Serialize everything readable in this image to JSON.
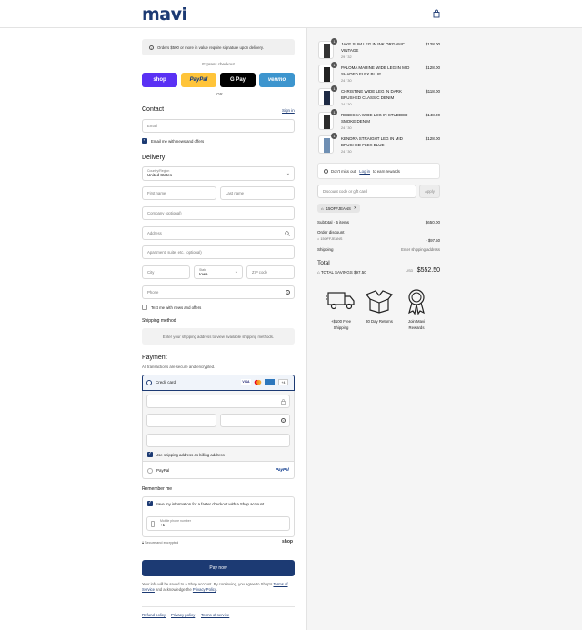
{
  "header": {
    "logo": "mavi",
    "cart_icon": "shopping-bag-icon"
  },
  "notice": {
    "text": "Orders $500 or more in value require signature upon delivery."
  },
  "express": {
    "title": "Express checkout",
    "buttons": [
      {
        "label": "shop",
        "color": "#5a31f4"
      },
      {
        "label": "PayPal",
        "color": "#ffc439"
      },
      {
        "label": "G Pay",
        "color": "#000000"
      },
      {
        "label": "venmo",
        "color": "#3d95ce"
      }
    ],
    "or": "OR"
  },
  "contact": {
    "title": "Contact",
    "signin": "Sign in",
    "email_placeholder": "Email",
    "email_news": "Email me with news and offers"
  },
  "delivery": {
    "title": "Delivery",
    "country_label": "Country/Region",
    "country_value": "United States",
    "first_name": "First name",
    "last_name": "Last name",
    "company": "Company (optional)",
    "address": "Address",
    "apartment": "Apartment, suite, etc. (optional)",
    "city": "City",
    "state_label": "State",
    "state_value": "Iowa",
    "zip": "ZIP code",
    "phone": "Phone",
    "text_news": "Text me with news and offers"
  },
  "shipping_method": {
    "title": "Shipping method",
    "message": "Enter your shipping address to view available shipping methods."
  },
  "payment": {
    "title": "Payment",
    "subtitle": "All transactions are secure and encrypted.",
    "credit_card": "Credit card",
    "card_brands": [
      "visa",
      "mastercard",
      "amex"
    ],
    "more": "+4",
    "billing": "Use shipping address as billing address",
    "paypal": "PayPal",
    "paypal_logo": "PayPal"
  },
  "remember": {
    "title": "Remember me",
    "save_info": "Save my information for a faster checkout with a Shop account",
    "mobile_label": "Mobile phone number",
    "mobile_value": "+1",
    "secure": "Secure and encrypted",
    "shop": "shop"
  },
  "pay_now": "Pay now",
  "legal": {
    "text1": "Your info will be saved to a Shop account. By continuing, you agree to Shop's",
    "terms": "Terms of Service",
    "text2": "and acknowledge the",
    "privacy": "Privacy Policy",
    "end": "."
  },
  "footer": [
    "Refund policy",
    "Privacy policy",
    "Terms of service"
  ],
  "items": [
    {
      "qty": "1",
      "name": "JAKE SLIM LEG IN INK ORGANIC VINTAGE",
      "variant": "29 / 32",
      "price": "$128.00"
    },
    {
      "qty": "1",
      "name": "PALOMA MARINE WIDE LEG IN MID SHADED FLEX BLUE",
      "variant": "24 / 30",
      "price": "$128.00"
    },
    {
      "qty": "1",
      "name": "CHRISTINE WIDE LEG IN DARK BRUSHED CLASSIC DENIM",
      "variant": "24 / 30",
      "price": "$118.00"
    },
    {
      "qty": "1",
      "name": "REBECCA WIDE LEG IN STUDDED SMOKE DENIM",
      "variant": "24 / 30",
      "price": "$148.00"
    },
    {
      "qty": "1",
      "name": "KENDRA STRAIGHT LEG IN MID BRUSHED FLEX BLUE",
      "variant": "24 / 30",
      "price": "$128.00"
    }
  ],
  "rewards": {
    "pre": "Don't miss out!",
    "link": "Log in",
    "post": "to earn rewards"
  },
  "discount": {
    "placeholder": "Discount code or gift card",
    "apply": "Apply",
    "tag": "15OFFJEANS"
  },
  "totals": {
    "subtotal_label": "Subtotal · 5 items",
    "subtotal": "$650.00",
    "order_discount": "Order discount",
    "code": "15OFFJEANS",
    "discount": "- $97.50",
    "shipping_label": "Shipping",
    "shipping_value": "Enter shipping address",
    "total_label": "Total",
    "currency": "USD",
    "total": "$552.50",
    "savings_label": "TOTAL SAVINGS",
    "savings": "$97.50"
  },
  "features": [
    {
      "icon": "delivery-truck-icon",
      "label": "+$100 Free Shipping"
    },
    {
      "icon": "open-box-icon",
      "label": "30 Day Returns"
    },
    {
      "icon": "award-ribbon-icon",
      "label": "Join Mavi Rewards"
    }
  ]
}
